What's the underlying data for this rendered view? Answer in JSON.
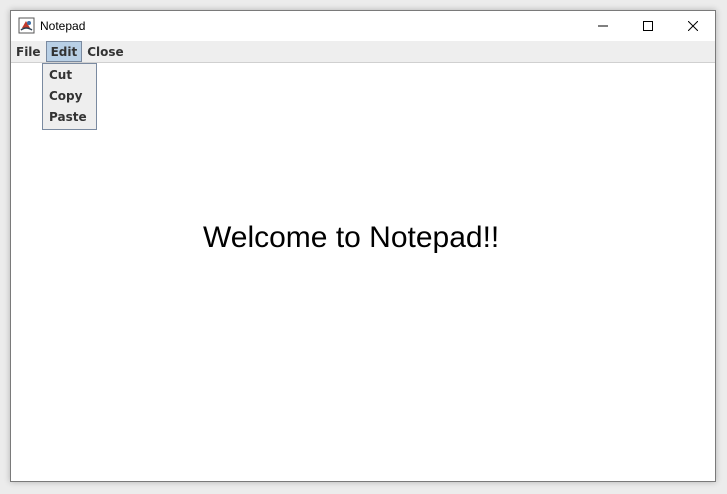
{
  "window": {
    "title": "Notepad",
    "icon": "java-app-icon",
    "controls": {
      "minimize": "minimize-icon",
      "maximize": "maximize-icon",
      "close": "close-icon"
    }
  },
  "menubar": {
    "items": [
      {
        "label": "File"
      },
      {
        "label": "Edit"
      },
      {
        "label": "Close"
      }
    ],
    "active_index": 1
  },
  "edit_menu": {
    "items": [
      {
        "label": "Cut"
      },
      {
        "label": "Copy"
      },
      {
        "label": "Paste"
      }
    ]
  },
  "content": {
    "welcome_text": "Welcome to Notepad!!"
  },
  "colors": {
    "menu_highlight": "#b8cfe5",
    "menu_border": "#7a8aa0",
    "menubar_bg": "#eeeeee"
  }
}
